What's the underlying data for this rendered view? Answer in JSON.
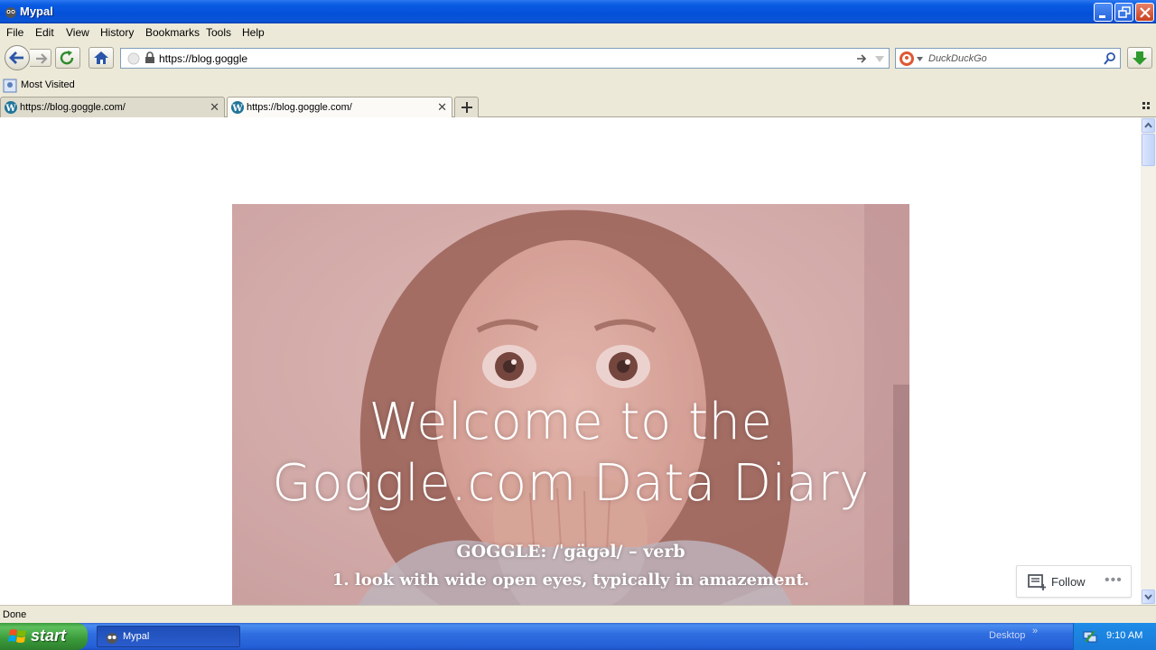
{
  "window": {
    "title": "Mypal"
  },
  "menu": {
    "items": [
      "File",
      "Edit",
      "View",
      "History",
      "Bookmarks",
      "Tools",
      "Help"
    ]
  },
  "navbar": {
    "url": "https://blog.goggle",
    "search_placeholder": "DuckDuckGo"
  },
  "bookmarks": {
    "items": [
      "Most Visited"
    ]
  },
  "tabs": [
    {
      "label": "https://blog.goggle.com/",
      "active": false
    },
    {
      "label": "https://blog.goggle.com/",
      "active": true
    }
  ],
  "page": {
    "hero_title_line1": "Welcome to the",
    "hero_title_line2": "Goggle.com Data Diary",
    "hero_sub1": "GOGGLE: /ˈgägəl/ – verb",
    "hero_sub2": "1. look with wide open eyes, typically in amazement.",
    "follow_label": "Follow",
    "more_label": "•••"
  },
  "status": {
    "text": "Done"
  },
  "taskbar": {
    "start_label": "start",
    "task_label": "Mypal",
    "desktop_label": "Desktop",
    "desktop_chevron": "»",
    "clock": "9:10 AM"
  },
  "colors": {
    "titlebar": "#0a5ce2",
    "chrome": "#ece9d8",
    "hero_tint": "#c99a96",
    "taskbar": "#245ed6",
    "start": "#3a9a3a"
  }
}
